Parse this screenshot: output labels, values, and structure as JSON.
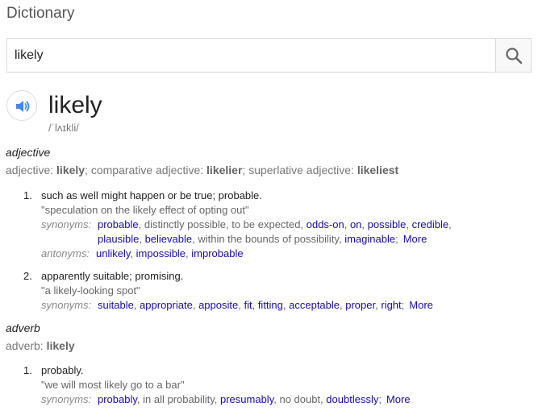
{
  "app": {
    "title": "Dictionary"
  },
  "search": {
    "value": "likely"
  },
  "entry": {
    "word": "likely",
    "phonetic": "/ˈlʌɪkli/"
  },
  "adjective": {
    "pos": "adjective",
    "forms_label1": "adjective: ",
    "form1": "likely",
    "sep1": "; comparative adjective: ",
    "form2": "likelier",
    "sep2": "; superlative adjective: ",
    "form3": "likeliest",
    "senses": [
      {
        "num": "1.",
        "definition": "such as well might happen or be true; probable.",
        "example": "\"speculation on the likely effect of opting out\"",
        "synonyms_label": "synonyms:",
        "synonyms_line1": [
          "probable",
          ", distinctly possible, to be expected, ",
          "odds-on",
          ", ",
          "on",
          ", ",
          "possible",
          ", ",
          "credible",
          ","
        ],
        "synonyms_line2": [
          "plausible",
          ", ",
          "believable",
          ", within the bounds of possibility, ",
          "imaginable",
          ";"
        ],
        "more": "More",
        "antonyms_label": "antonyms:",
        "antonyms": [
          "unlikely",
          ", ",
          "impossible",
          ", ",
          "improbable"
        ]
      },
      {
        "num": "2.",
        "definition": "apparently suitable; promising.",
        "example": "\"a likely-looking spot\"",
        "synonyms_label": "synonyms:",
        "synonyms": [
          "suitable",
          ", ",
          "appropriate",
          ", ",
          "apposite",
          ", ",
          "fit",
          ", ",
          "fitting",
          ", ",
          "acceptable",
          ", ",
          "proper",
          ", ",
          "right",
          ";"
        ],
        "more": "More"
      }
    ]
  },
  "adverb": {
    "pos": "adverb",
    "forms_label1": "adverb: ",
    "form1": "likely",
    "senses": [
      {
        "num": "1.",
        "definition": "probably.",
        "example": "\"we will most likely go to a bar\"",
        "synonyms_label": "synonyms:",
        "synonyms": [
          "probably",
          ", in all probability, ",
          "presumably",
          ", no doubt, ",
          "doubtlessly",
          ";"
        ],
        "more": "More"
      }
    ]
  },
  "icons": {
    "search": "search-icon",
    "speaker": "speaker-icon"
  },
  "colors": {
    "link": "#1a0dab",
    "speaker": "#4285f4"
  }
}
